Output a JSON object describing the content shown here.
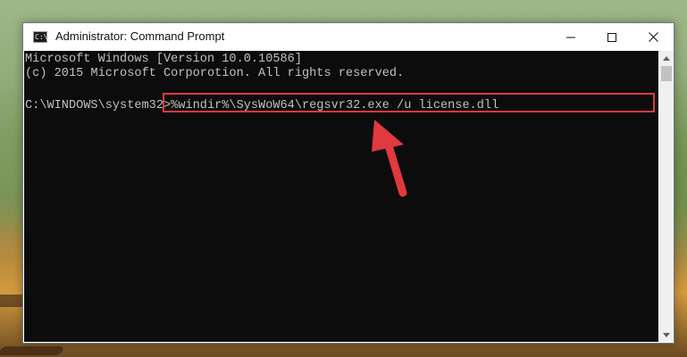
{
  "window": {
    "title": "Administrator: Command Prompt",
    "icon_text": "C:\\"
  },
  "controls": {
    "minimize": "minimize-icon",
    "maximize": "maximize-icon",
    "close": "close-icon"
  },
  "console": {
    "lines": [
      "Microsoft Windows [Version 10.0.10586]",
      "(c) 2015 Microsoft Corporotion. All rights reserved."
    ],
    "prompt": "C:\\WINDOWS\\system32>",
    "command": "%windir%\\SysWoW64\\regsvr32.exe /u license.dll"
  },
  "colors": {
    "highlight": "#e0393e",
    "arrow": "#e0393e",
    "console_bg": "#0c0c0c",
    "console_text": "#c0c0c0"
  }
}
